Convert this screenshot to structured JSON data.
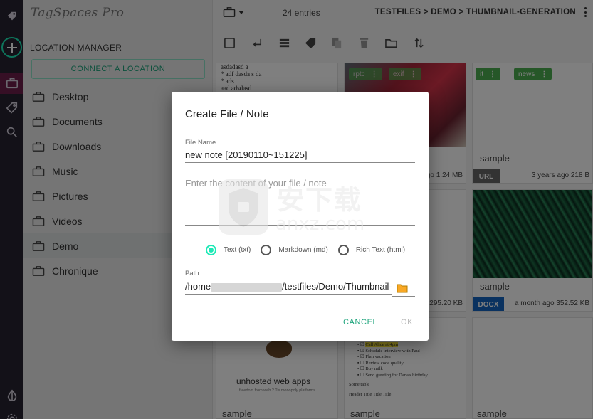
{
  "sidebar_icons": [
    "tagspaces-logo-icon",
    "add-icon",
    "locations-icon",
    "tag-icon",
    "search-icon",
    "theme-icon",
    "settings-icon"
  ],
  "app": {
    "logo": "TagSpaces Pro"
  },
  "location_manager": {
    "title": "LOCATION MANAGER",
    "connect_label": "CONNECT A LOCATION",
    "locations": [
      "Desktop",
      "Documents",
      "Downloads",
      "Music",
      "Pictures",
      "Videos",
      "Demo",
      "Chronique"
    ],
    "active": "Demo"
  },
  "header": {
    "entries": "24 entries",
    "breadcrumb": "TESTFILES > DEMO > THUMBNAIL-GENERATION"
  },
  "toolbar": [
    "select-all-icon",
    "parent-folder-icon",
    "list-view-icon",
    "tag-icon",
    "copy-icon",
    "delete-icon",
    "folder-icon",
    "sort-icon"
  ],
  "cards": {
    "c1": {
      "text_lines": [
        "asdadasd a",
        "* adf dasda s da",
        "* ads",
        "aad adsdasd"
      ]
    },
    "c2": {
      "tags": [
        "rptc",
        "exif"
      ],
      "meta": "ago 1.24 MB"
    },
    "c3": {
      "tags": [
        "it",
        "news"
      ],
      "title": "sample",
      "ext": "URL",
      "meta": "3 years ago 218 B"
    },
    "c5": {
      "meta": "295.20 KB"
    },
    "c6": {
      "title": "sample",
      "ext": "DOCX",
      "meta": "a month ago 352.52 KB"
    },
    "c7": {
      "thumb_title": "unhosted web apps",
      "thumb_sub": "freedom from web 2.0's monopoly platforms",
      "title": "sample"
    },
    "c8": {
      "todo": [
        "Call Alice at 4pm",
        "Schedule interview with Paul",
        "Plan vacation",
        "Review code quality",
        "Buy milk",
        "Send greeting for Dana's birthday"
      ],
      "table_caption": "Some table",
      "table_header": "Header     Title  Title  Title",
      "title": "sample"
    },
    "c9": {
      "title": "sample"
    }
  },
  "dialog": {
    "title": "Create File / Note",
    "filename_label": "File Name",
    "filename_value": "new note [20190110~151225]",
    "content_placeholder": "Enter the content of your file / note",
    "formats": [
      "Text (txt)",
      "Markdown (md)",
      "Rich Text (html)"
    ],
    "selected_format": "Text (txt)",
    "path_label": "Path",
    "path_prefix": "/home",
    "path_suffix": "/testfiles/Demo/Thumbnail-",
    "cancel": "CANCEL",
    "ok": "OK"
  },
  "watermark": {
    "cn": "安下载",
    "en": "anxz.com"
  },
  "colors": {
    "accent": "#1de9b6",
    "tag_green": "#4caf50",
    "sidebar_dark": "#262230",
    "url_badge": "#666666",
    "docx_badge": "#1565c0"
  }
}
